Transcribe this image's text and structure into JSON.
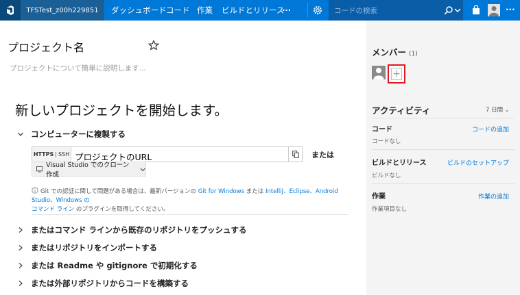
{
  "header": {
    "project": "TFSTest_z00h229851",
    "nav": [
      "ダッシュボード",
      "コード",
      "作業",
      "ビルドとリリース"
    ],
    "more": "···",
    "search_placeholder": "コードの検索",
    "colors": {
      "bar": "#0078d7",
      "project_tab": "#1a5f96"
    }
  },
  "main": {
    "project_name": "プロジェクト名",
    "description_placeholder": "プロジェクトについて簡単に説明します...",
    "heading": "新しいプロジェクトを開始します。",
    "clone_section": "コンピューターに複製する",
    "protocols": {
      "https": "HTTPS",
      "sep": "|",
      "ssh": "SSH"
    },
    "url_value": "プロジェクトのURL",
    "or": "または",
    "vs_clone": "Visual Studio でのクローン作成",
    "info": {
      "pre": "Git での認証に関して問題がある場合は、最新バージョンの",
      "git_for_windows": "Git for Windows",
      "mid": "または",
      "ides": "IntelliJ、Eclipse、Android Studio、Windows の",
      "cli": "コマンド ライン",
      "post": "のプラグインを取得してください。"
    },
    "sections": [
      "またはコマンド ラインから既存のリポジトリをプッシュする",
      "またはリポジトリをインポートする",
      "または Readme や gitignore で初期化する",
      "または外部リポジトリからコードを構築する"
    ]
  },
  "panel": {
    "members_title": "メンバー",
    "members_count": "(1)",
    "add_symbol": "+",
    "activity_title": "アクティビティ",
    "days": "7 日間",
    "items": [
      {
        "label": "コード",
        "sub": "コードなし",
        "link": "コードの追加"
      },
      {
        "label": "ビルドとリリース",
        "sub": "ビルドなし",
        "link": "ビルドのセットアップ"
      },
      {
        "label": "作業",
        "sub": "作業項目なし",
        "link": "作業の追加"
      }
    ],
    "highlight_color": "#e0181f"
  }
}
